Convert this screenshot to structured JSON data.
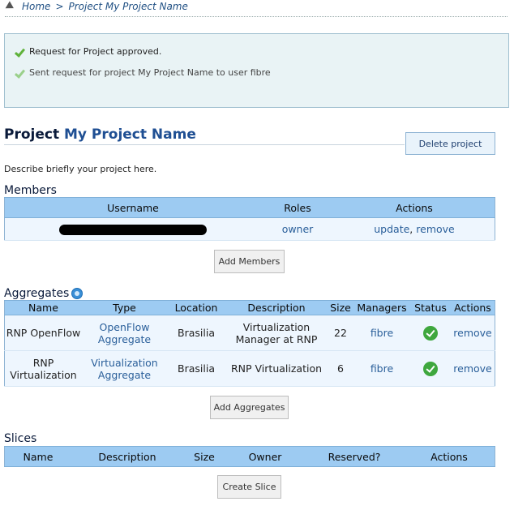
{
  "breadcrumb": {
    "home": "Home",
    "separator": ">",
    "current": "Project My Project Name"
  },
  "messages": [
    {
      "text": "Request for Project approved."
    },
    {
      "text": "Sent request for project My Project Name to user fibre"
    }
  ],
  "project": {
    "title_prefix": "Project",
    "name": "My Project Name",
    "delete_label": "Delete project",
    "description": "Describe briefly your project here."
  },
  "members": {
    "heading": "Members",
    "columns": [
      "Username",
      "Roles",
      "Actions"
    ],
    "rows": [
      {
        "username": "",
        "role": "owner",
        "action_update": "update",
        "action_sep": ",",
        "action_remove": "remove"
      }
    ],
    "add_label": "Add Members"
  },
  "aggregates": {
    "heading": "Aggregates",
    "columns": [
      "Name",
      "Type",
      "Location",
      "Description",
      "Size",
      "Managers",
      "Status",
      "Actions"
    ],
    "rows": [
      {
        "name": "RNP OpenFlow",
        "type": "OpenFlow Aggregate",
        "location": "Brasilia",
        "description": "Virtualization Manager at RNP",
        "size": "22",
        "managers": "fibre",
        "status": "ok",
        "action": "remove"
      },
      {
        "name": "RNP Virtualization",
        "type": "Virtualization Aggregate",
        "location": "Brasilia",
        "description": "RNP Virtualization",
        "size": "6",
        "managers": "fibre",
        "status": "ok",
        "action": "remove"
      }
    ],
    "add_label": "Add Aggregates"
  },
  "slices": {
    "heading": "Slices",
    "columns": [
      "Name",
      "Description",
      "Size",
      "Owner",
      "Reserved?",
      "Actions"
    ],
    "create_label": "Create Slice"
  },
  "colors": {
    "header_bg": "#9dcbf2",
    "row_bg": "#eef6fe",
    "link": "#2a5f9a",
    "title": "#1f4f93"
  }
}
